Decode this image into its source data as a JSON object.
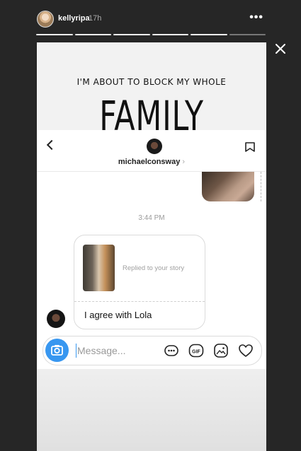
{
  "story": {
    "username": "kellyripa",
    "time_ago": "17h",
    "segments_total": 6,
    "segments_viewed": 5
  },
  "caption": {
    "line1": "I'M ABOUT TO BLOCK MY WHOLE",
    "line2": "FAMILY"
  },
  "dm": {
    "username": "michaelconsway",
    "chevron": "›",
    "timestamp": "3:44 PM",
    "replied_label": "Replied to your story",
    "message_text": "I agree with Lola",
    "composer_placeholder": "Message...",
    "gif_label": "GIF"
  },
  "colors": {
    "accent": "#3897f0",
    "story_background": "#262626"
  },
  "icons": [
    "close-icon",
    "more-options-icon",
    "back-chevron-icon",
    "flag-icon",
    "camera-icon",
    "sticker-icon",
    "gif-icon",
    "gallery-icon",
    "heart-icon"
  ]
}
